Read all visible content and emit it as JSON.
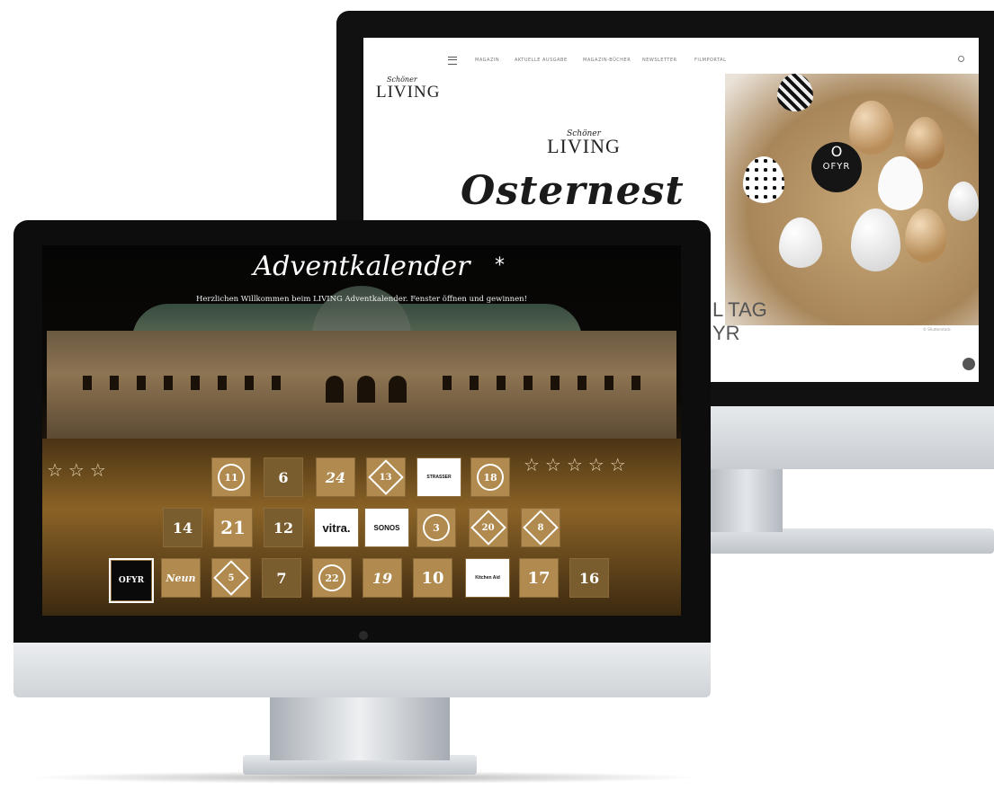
{
  "back_site": {
    "nav": [
      "MAGAZIN",
      "AKTUELLE AUSGABE",
      "MAGAZIN-BÜCHER",
      "NEWSLETTER",
      "FILMPORTAL"
    ],
    "logo": {
      "script": "Schöner",
      "word": "LIVING"
    },
    "hero": {
      "logo_script": "Schöner",
      "logo_word": "LIVING",
      "headline": "Osternest",
      "tagline_lines": [
        "L TAG",
        "YR"
      ]
    },
    "badge": {
      "brand": "OFYR",
      "symbol": "O"
    },
    "photo_credit": "© Shutterstock"
  },
  "advent": {
    "title": "Adventkalender",
    "subtitle": "Herzlichen Willkommen beim LIVING Adventkalender. Fenster öffnen und gewinnen!",
    "star": "*",
    "doors": [
      {
        "label": "11",
        "style": "circle"
      },
      {
        "label": "6",
        "style": "dark"
      },
      {
        "label": "24",
        "style": "plain"
      },
      {
        "label": "13",
        "style": "diamond"
      },
      {
        "label": "STRASSER",
        "style": "white"
      },
      {
        "label": "18",
        "style": "circle"
      },
      {
        "label": "14",
        "style": "dark"
      },
      {
        "label": "21",
        "style": "plain"
      },
      {
        "label": "12",
        "style": "dark"
      },
      {
        "label": "vitra.",
        "style": "white"
      },
      {
        "label": "SONOS",
        "style": "white"
      },
      {
        "label": "3",
        "style": "circle"
      },
      {
        "label": "20",
        "style": "diamond"
      },
      {
        "label": "8",
        "style": "diamond"
      },
      {
        "label": "OFYR",
        "style": "black"
      },
      {
        "label": "Neun",
        "style": "plain"
      },
      {
        "label": "5",
        "style": "diamond"
      },
      {
        "label": "7",
        "style": "dark"
      },
      {
        "label": "22",
        "style": "circle"
      },
      {
        "label": "19",
        "style": "plain"
      },
      {
        "label": "10",
        "style": "plain"
      },
      {
        "label": "Kitchen Aid",
        "style": "white"
      },
      {
        "label": "17",
        "style": "plain"
      },
      {
        "label": "16",
        "style": "dark"
      }
    ]
  }
}
